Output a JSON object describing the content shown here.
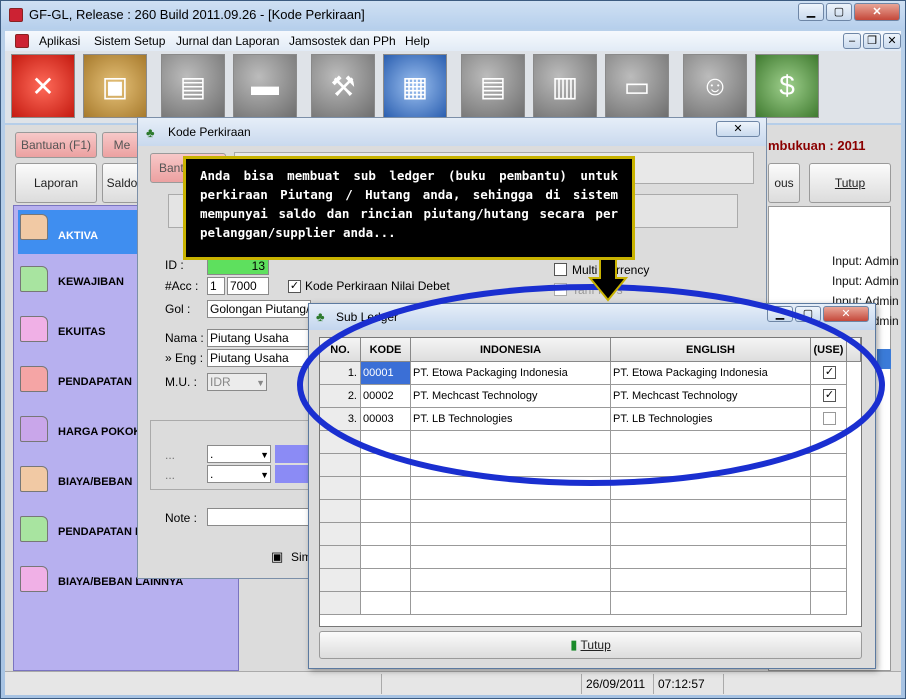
{
  "window": {
    "title": "GF-GL, Release : 260 Build 2011.09.26 - [Kode Perkiraan]",
    "min": "▭",
    "max": "▢",
    "close": "✕"
  },
  "menu": [
    "Aplikasi",
    "Sistem Setup",
    "Jurnal dan Laporan",
    "Jamsostek dan PPh",
    "Help"
  ],
  "toolbar_icons": [
    "close-icon",
    "zip-icon",
    "cabinet-icon",
    "car-icon",
    "stamp-icon",
    "spreadsheet-icon",
    "documents-icon",
    "clipboard-icon",
    "printer-icon",
    "users-icon",
    "money-icon"
  ],
  "main": {
    "bantuan": "Bantuan (F1)",
    "me_partial": "Me",
    "laporan": "Laporan",
    "saldo_partial": "Saldo",
    "ous_partial": "ous",
    "tutup": "Tutup",
    "periode_partial": "mbukuan : 2011",
    "input_labels": [
      "Input: Admin",
      "Input: Admin",
      "Input: Admin",
      "Input: Admin"
    ]
  },
  "nav": [
    "AKTIVA",
    "KEWAJIBAN",
    "EKUITAS",
    "PENDAPATAN",
    "HARGA POKOK",
    "BIAYA/BEBAN",
    "PENDAPATAN L",
    "BIAYA/BEBAN LAINNYA"
  ],
  "nav_colors": [
    "#f1c9a4",
    "#a8e4a0",
    "#f0b0e6",
    "#f5a5a5",
    "#c9a6ea",
    "#f1c9a4",
    "#a8e4a0",
    "#f0b0e6"
  ],
  "kode": {
    "title": "Kode Perkiraan",
    "bantu_partial": "Bantu",
    "id_label": "ID :",
    "id_value": "13",
    "acc_label": "#Acc :",
    "acc_prefix": "1",
    "acc_value": "7000",
    "nilai_debet_label": "Kode Perkiraan Nilai Debet",
    "nilai_debet_checked": "✓",
    "gol_label": "Gol :",
    "gol_value": "Golongan Piutang/H",
    "nama_label": "Nama :",
    "nama_value": "Piutang Usaha",
    "eng_label": "» Eng :",
    "eng_value": "Piutang Usaha",
    "mu_label": "M.U. :",
    "mu_value": "IDR",
    "multi_currency": "Multi Currency",
    "tarif_kurs": "Tarif Kurs",
    "dots1": "...",
    "dots2": "...",
    "dot_a": ".",
    "dot_b": ".",
    "note_label": "Note :",
    "simpan_partial": "Sim"
  },
  "tooltip": "Anda bisa membuat sub ledger (buku pembantu) untuk perkiraan Piutang / Hutang anda, sehingga di sistem mempunyai saldo dan rincian piutang/hutang secara per pelanggan/supplier anda...",
  "sub": {
    "title": "Sub Ledger",
    "headers": [
      "NO.",
      "KODE",
      "INDONESIA",
      "ENGLISH",
      "(USE)"
    ],
    "rows": [
      {
        "no": "1.",
        "kode": "00001",
        "indonesia": "PT. Etowa Packaging Indonesia",
        "english": "PT. Etowa Packaging Indonesia",
        "use": "✓"
      },
      {
        "no": "2.",
        "kode": "00002",
        "indonesia": "PT. Mechcast Technology",
        "english": "PT. Mechcast Technology",
        "use": "✓"
      },
      {
        "no": "3.",
        "kode": "00003",
        "indonesia": "PT. LB Technologies",
        "english": "PT. LB Technologies",
        "use": ""
      }
    ],
    "tutup": "Tutup"
  },
  "status": {
    "date": "26/09/2011",
    "time": "07:12:57"
  },
  "accent_blue": "#1a2fd0"
}
